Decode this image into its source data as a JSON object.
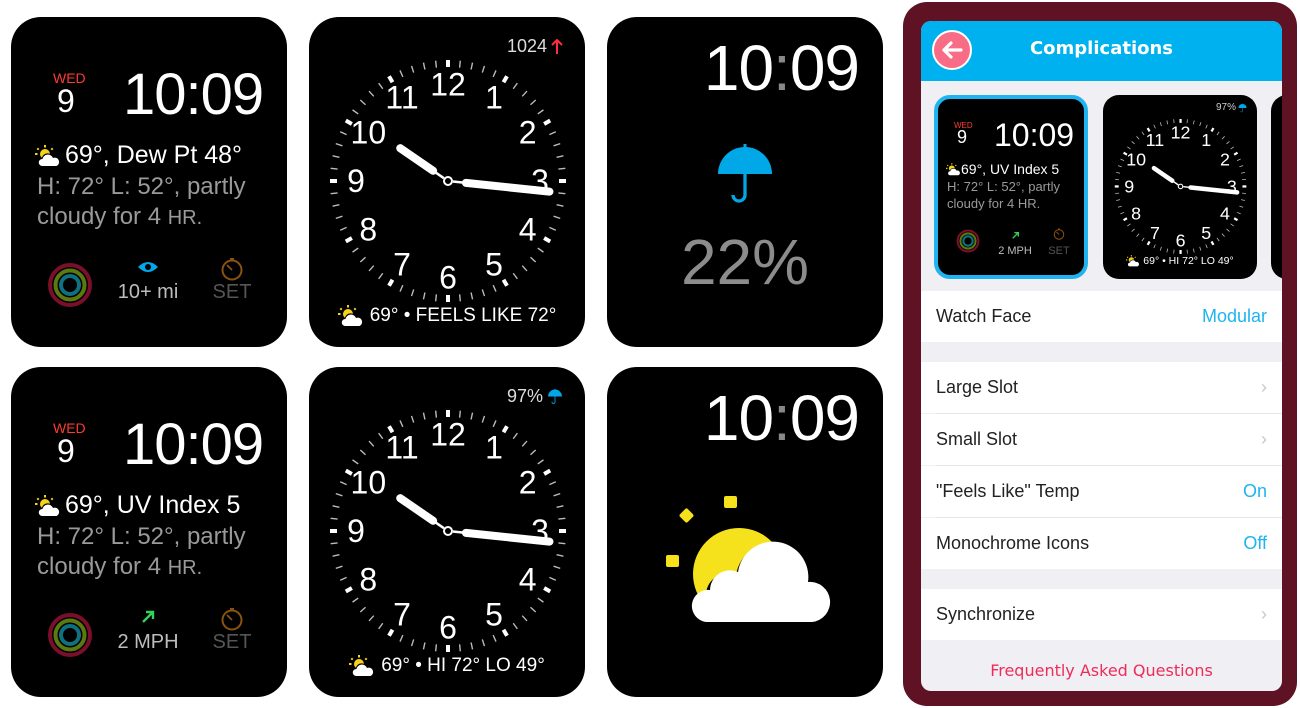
{
  "faces": {
    "modular_dewpoint": {
      "day": "WED",
      "date": "9",
      "time": "10:09",
      "line1": "69°, Dew Pt 48°",
      "line2": "H: 72° L: 52°, partly",
      "line3_prefix": "cloudy for 4 ",
      "line3_unit": "HR.",
      "comp_mid_icon": "eye-icon",
      "comp_mid_label": "10+ mi",
      "comp_right_label": "SET"
    },
    "analog_pressure": {
      "top_value": "1024",
      "top_icon": "arrow-up-icon",
      "bottom_text": "69° • FEELS LIKE 72°",
      "numerals": [
        "12",
        "1",
        "2",
        "3",
        "4",
        "5",
        "6",
        "7",
        "8",
        "9",
        "10",
        "11"
      ],
      "time_hours": 10,
      "time_minutes": 9
    },
    "digital_precip": {
      "time_h": "10",
      "time_colon": ":",
      "time_m": "09",
      "icon": "umbrella-icon",
      "value": "22%"
    },
    "modular_uv": {
      "day": "WED",
      "date": "9",
      "time": "10:09",
      "line1": "69°, UV Index 5",
      "line2": "H: 72° L: 52°, partly",
      "line3_prefix": "cloudy for 4 ",
      "line3_unit": "HR.",
      "comp_mid_icon": "wind-arrow-icon",
      "comp_mid_label": "2 MPH",
      "comp_right_label": "SET"
    },
    "analog_hilo": {
      "top_value": "97%",
      "top_icon": "umbrella-icon",
      "bottom_text": "69° • HI 72° LO 49°",
      "numerals": [
        "12",
        "1",
        "2",
        "3",
        "4",
        "5",
        "6",
        "7",
        "8",
        "9",
        "10",
        "11"
      ],
      "time_hours": 10,
      "time_minutes": 9
    },
    "digital_condition": {
      "time_h": "10",
      "time_colon": ":",
      "time_m": "09",
      "icon": "partly-cloudy-icon"
    }
  },
  "phone": {
    "title": "Complications",
    "back_icon": "arrow-left-icon",
    "thumbnails": [
      {
        "selected": true,
        "day": "WED",
        "date": "9",
        "time": "10:09",
        "line1": "69°, UV Index 5",
        "line2": "H: 72° L: 52°, partly",
        "line3": "cloudy for 4 HR.",
        "comp_mid_label": "2 MPH",
        "comp_right_label": "SET"
      },
      {
        "selected": false,
        "top_value": "97%",
        "bottom_text": "69° • HI 72° LO 49°"
      }
    ],
    "settings": [
      {
        "label": "Watch Face",
        "value": "Modular"
      },
      {
        "label": "Large Slot",
        "value": "›"
      },
      {
        "label": "Small Slot",
        "value": "›"
      },
      {
        "label": "\"Feels Like\" Temp",
        "value": "On"
      },
      {
        "label": "Monochrome Icons",
        "value": "Off"
      },
      {
        "label": "Synchronize",
        "value": "›"
      }
    ],
    "faq_link": "Frequently Asked Questions"
  },
  "colors": {
    "accent_blue": "#00b1ef",
    "phone_frame": "#5e1224",
    "faq_red": "#ef2b5a",
    "back_button": "#f86c85",
    "day_red": "#ff3b30"
  }
}
